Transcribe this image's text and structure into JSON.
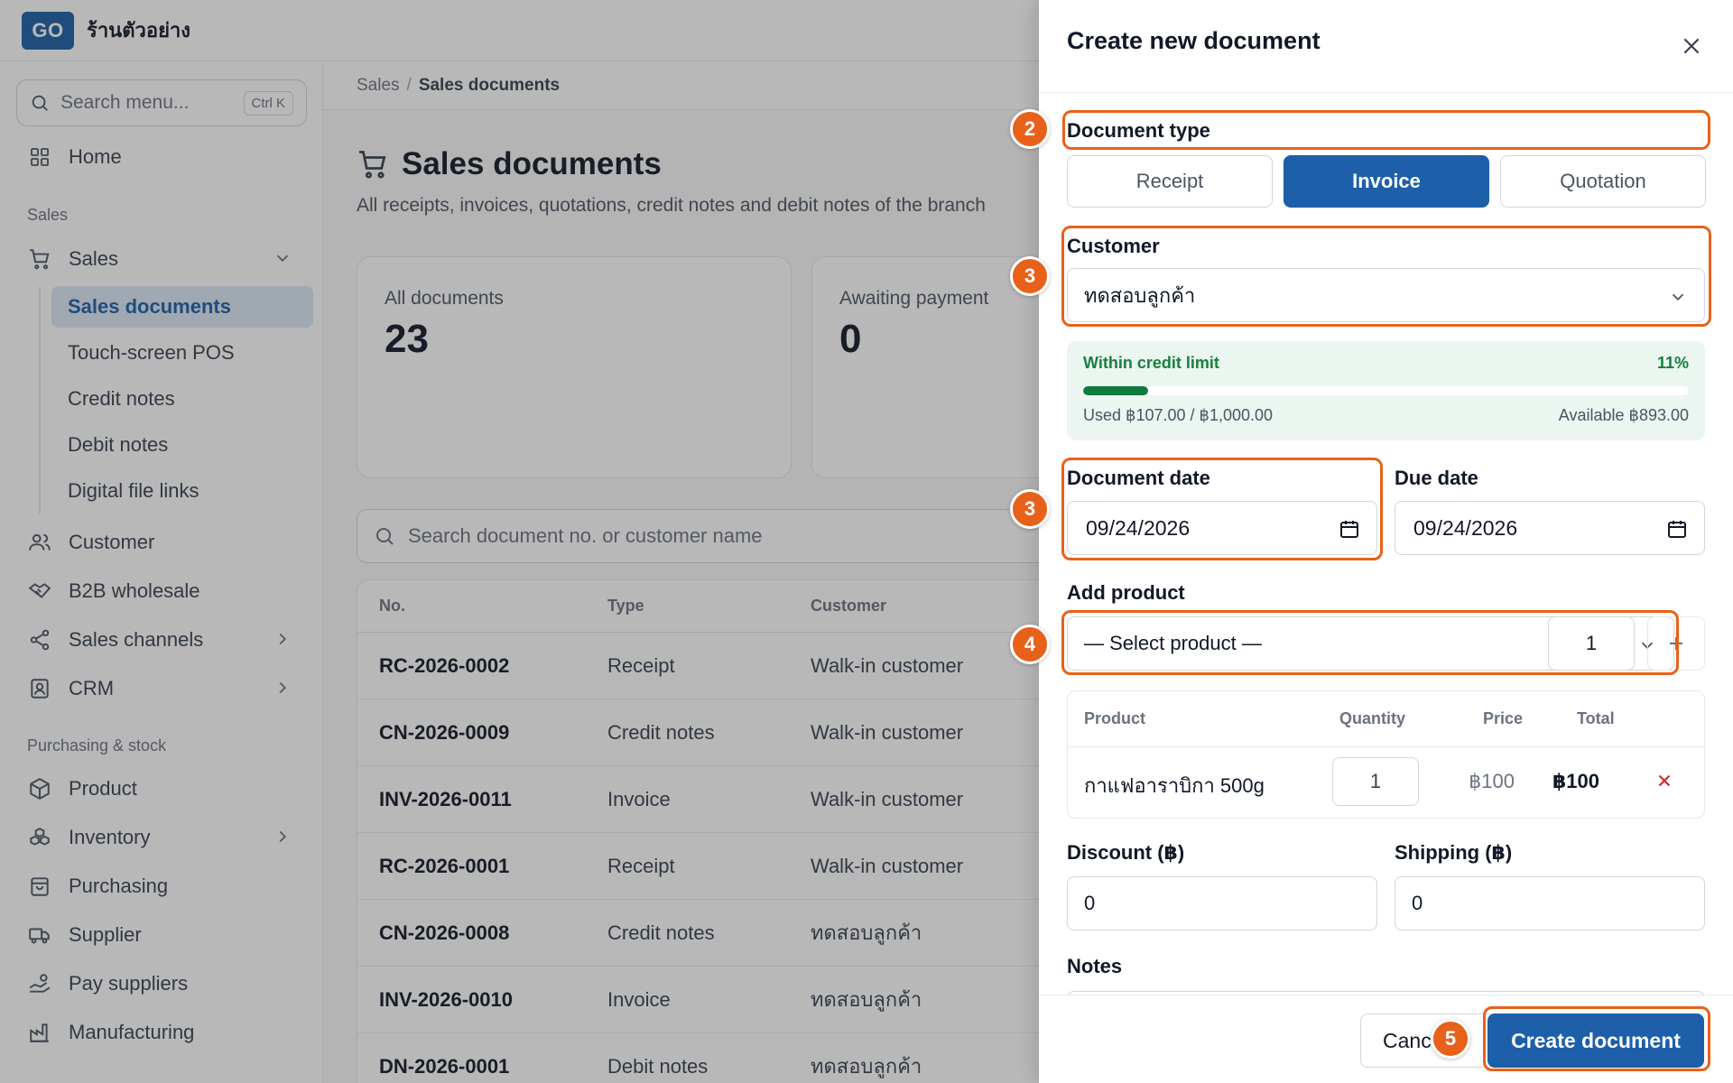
{
  "app": {
    "logo": "GO",
    "shop_name": "ร้านตัวอย่าง"
  },
  "sidebar": {
    "search_placeholder": "Search menu...",
    "search_shortcut": "Ctrl K",
    "home": "Home",
    "section_sales": "Sales",
    "sales": "Sales",
    "sub_items": [
      "Sales documents",
      "Touch-screen POS",
      "Credit notes",
      "Debit notes",
      "Digital file links"
    ],
    "customer": "Customer",
    "b2b": "B2B wholesale",
    "sales_channels": "Sales channels",
    "crm": "CRM",
    "section_purchasing": "Purchasing & stock",
    "product": "Product",
    "inventory": "Inventory",
    "purchasing": "Purchasing",
    "supplier": "Supplier",
    "pay_suppliers": "Pay suppliers",
    "manufacturing": "Manufacturing"
  },
  "main": {
    "breadcrumb": {
      "parent": "Sales",
      "separator": "/",
      "current": "Sales documents"
    },
    "title": "Sales documents",
    "subtitle": "All receipts, invoices, quotations, credit notes and debit notes of the branch",
    "stats": [
      {
        "label": "All documents",
        "value": "23"
      },
      {
        "label": "Awaiting payment",
        "value": "0"
      }
    ],
    "search_placeholder": "Search document no. or customer name",
    "table": {
      "headers": {
        "no": "No.",
        "type": "Type",
        "customer": "Customer"
      },
      "rows": [
        {
          "no": "RC-2026-0002",
          "type": "Receipt",
          "customer": "Walk-in customer"
        },
        {
          "no": "CN-2026-0009",
          "type": "Credit notes",
          "customer": "Walk-in customer"
        },
        {
          "no": "INV-2026-0011",
          "type": "Invoice",
          "customer": "Walk-in customer"
        },
        {
          "no": "RC-2026-0001",
          "type": "Receipt",
          "customer": "Walk-in customer"
        },
        {
          "no": "CN-2026-0008",
          "type": "Credit notes",
          "customer": "ทดสอบลูกค้า"
        },
        {
          "no": "INV-2026-0010",
          "type": "Invoice",
          "customer": "ทดสอบลูกค้า"
        },
        {
          "no": "DN-2026-0001",
          "type": "Debit notes",
          "customer": "ทดสอบลูกค้า"
        }
      ]
    }
  },
  "drawer": {
    "title": "Create new document",
    "doc_type_label": "Document type",
    "doc_types": [
      "Receipt",
      "Invoice",
      "Quotation"
    ],
    "selected_doc_type": "Invoice",
    "customer_label": "Customer",
    "customer_value": "ทดสอบลูกค้า",
    "credit": {
      "title": "Within credit limit",
      "percent_label": "11%",
      "fraction": 0.107,
      "used": "Used ฿107.00 / ฿1,000.00",
      "available": "Available ฿893.00"
    },
    "doc_date_label": "Document date",
    "doc_date": "09/24/2026",
    "due_date_label": "Due date",
    "due_date": "09/24/2026",
    "add_product_label": "Add product",
    "product_placeholder": "— Select product —",
    "add_qty": "1",
    "product_table": {
      "headers": {
        "product": "Product",
        "quantity": "Quantity",
        "price": "Price",
        "total": "Total"
      },
      "rows": [
        {
          "product": "กาแฟอาราบิกา 500g",
          "quantity": "1",
          "price": "฿100",
          "total": "฿100"
        }
      ]
    },
    "discount_label": "Discount (฿)",
    "discount_value": "0",
    "shipping_label": "Shipping (฿)",
    "shipping_value": "0",
    "notes_label": "Notes",
    "cancel_label": "Cancel",
    "create_label": "Create document"
  },
  "steps": [
    "2",
    "3",
    "3",
    "4",
    "5"
  ],
  "colors": {
    "brand": "#1d5fa8",
    "highlight": "#e8611a",
    "credit_ok": "#15803d"
  },
  "icons": [
    "search-icon",
    "grid-icon",
    "cart-icon",
    "users-icon",
    "handshake-icon",
    "share-icon",
    "crm-icon",
    "box-icon",
    "boxes-icon",
    "bag-icon",
    "truck-icon",
    "pay-icon",
    "factory-icon",
    "chevron-down-icon",
    "chevron-right-icon",
    "close-icon",
    "calendar-icon",
    "plus-icon",
    "delete-x-icon"
  ]
}
